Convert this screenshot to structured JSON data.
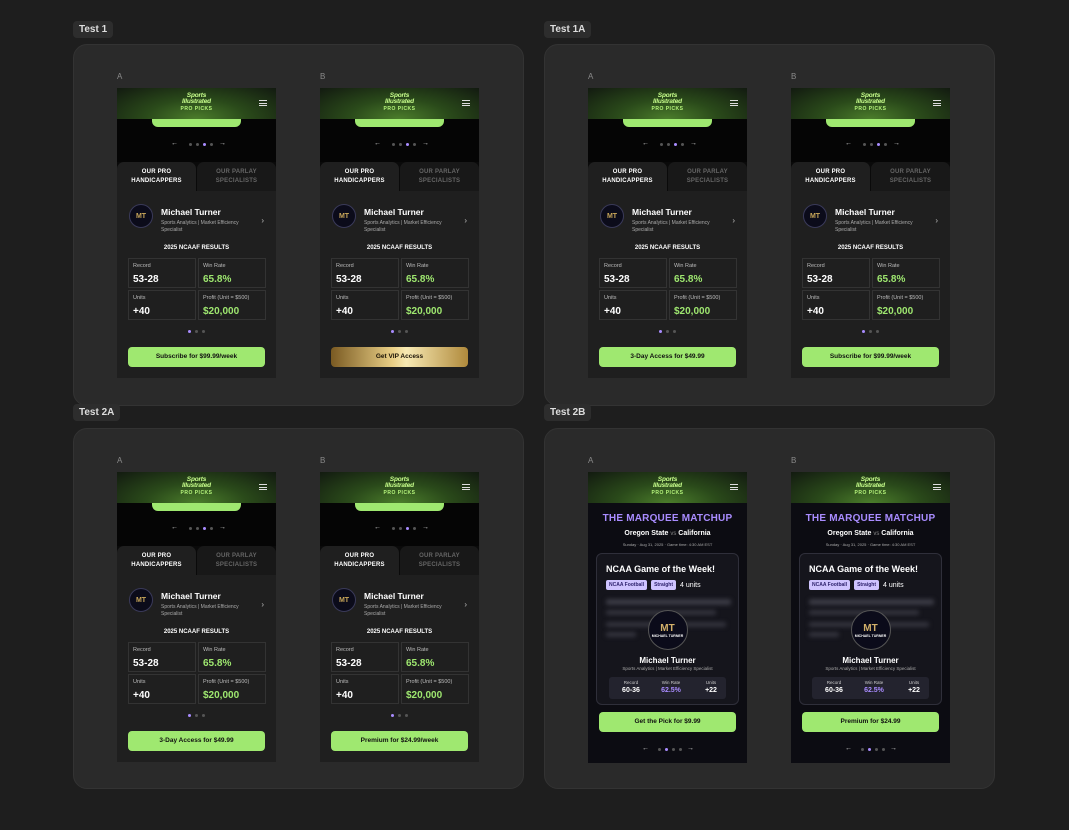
{
  "sections": [
    {
      "tag": "Test 1"
    },
    {
      "tag": "Test 1A"
    },
    {
      "tag": "Test 2A"
    },
    {
      "tag": "Test 2B"
    }
  ],
  "variant_labels": {
    "a": "A",
    "b": "B"
  },
  "brand": {
    "line1": "Sports",
    "line2": "Illustrated",
    "line3": "PRO PICKS",
    "accent": "#9fe870",
    "purple": "#a98cff"
  },
  "carousel": {
    "prev": "←",
    "next": "→"
  },
  "tabs": {
    "active": "OUR PRO HANDICAPPERS",
    "inactive": "OUR PARLAY SPECIALISTS"
  },
  "profile": {
    "name": "Michael Turner",
    "subtitle": "Sports Analytics | Market Efficiency Specialist",
    "avatar_text": "MT",
    "chevron": "›"
  },
  "results": {
    "title": "2025 NCAAF RESULTS",
    "record_label": "Record",
    "record": "53-28",
    "winrate_label": "Win Rate",
    "winrate": "65.8%",
    "units_label": "Units",
    "units": "+40",
    "profit_label": "Profit (Unit = $500)",
    "profit": "$20,000"
  },
  "ctas": {
    "t1a": "Subscribe for $99.99/week",
    "t1b": "Get VIP Access",
    "t1aa": "3-Day Access for $49.99",
    "t1ab": "Subscribe for $99.99/week",
    "t2aa": "3-Day Access for $49.99",
    "t2ab": "Premium for $24.99/week",
    "t2ba": "Get the Pick for $9.99",
    "t2bb": "Premium for $24.99"
  },
  "marquee": {
    "title": "THE MARQUEE MATCHUP",
    "home": "Oregon State",
    "vs": "vs",
    "away": "California",
    "date": "Sunday · Aug 31, 2025 · Game time: 4:30 AM EST",
    "card_title": "NCAA Game of the Week!",
    "badge1": "NCAA Football",
    "badge2": "Straight",
    "units": "4 units",
    "avatar_mono": "MT",
    "avatar_name": "MICHAEL TURNER",
    "name": "Michael Turner",
    "subtitle": "Sports Analytics | Market Efficiency Specialist",
    "record_label": "Record",
    "record": "60-36",
    "winrate_label": "Win Rate",
    "winrate": "62.5%",
    "units_label": "Units",
    "units_val": "+22"
  }
}
